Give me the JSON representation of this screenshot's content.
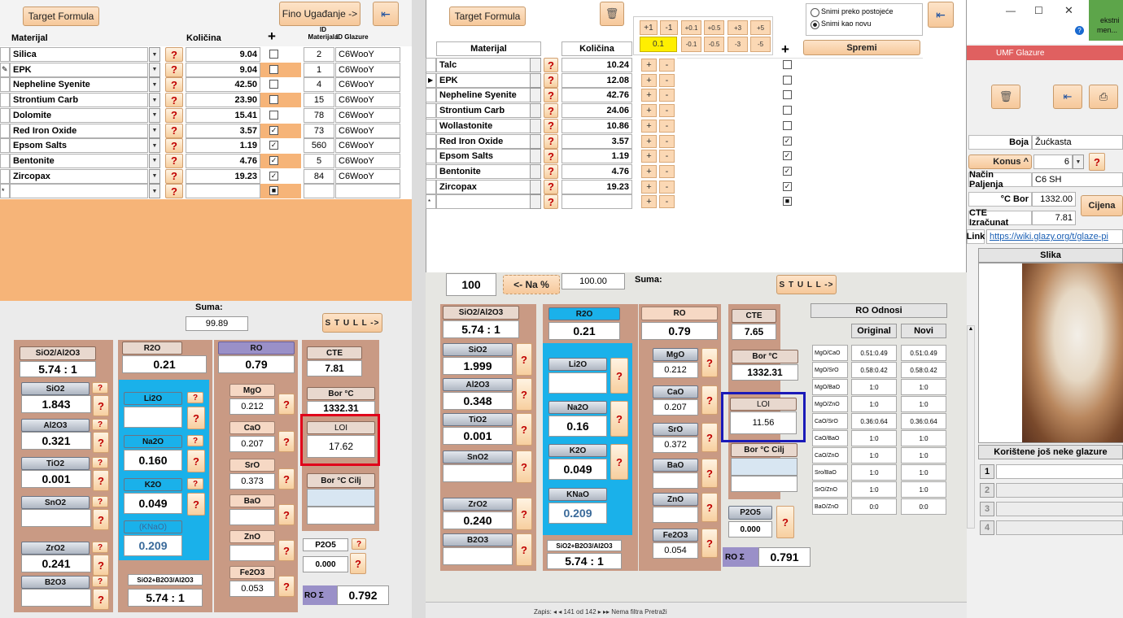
{
  "left": {
    "target_formula": "Target Formula",
    "fino": "Fino Ugađanje ->",
    "col_materijal": "Materijal",
    "col_kolicina": "Količina",
    "col_plus": "+",
    "col_id_mat": "ID Materijala",
    "col_id_glaz": "ID Glazure",
    "rows": [
      {
        "name": "Silica",
        "qty": "9.04",
        "checked": false,
        "id": "2",
        "glaze": "C6WooY"
      },
      {
        "name": "EPK",
        "qty": "9.04",
        "checked": false,
        "id": "1",
        "glaze": "C6WooY"
      },
      {
        "name": "Nepheline Syenite",
        "qty": "42.50",
        "checked": false,
        "id": "4",
        "glaze": "C6WooY"
      },
      {
        "name": "Strontium Carb",
        "qty": "23.90",
        "checked": false,
        "id": "15",
        "glaze": "C6WooY"
      },
      {
        "name": "Dolomite",
        "qty": "15.41",
        "checked": false,
        "id": "78",
        "glaze": "C6WooY"
      },
      {
        "name": "Red Iron Oxide",
        "qty": "3.57",
        "checked": true,
        "id": "73",
        "glaze": "C6WooY"
      },
      {
        "name": "Epsom Salts",
        "qty": "1.19",
        "checked": true,
        "id": "560",
        "glaze": "C6WooY"
      },
      {
        "name": "Bentonite",
        "qty": "4.76",
        "checked": true,
        "id": "5",
        "glaze": "C6WooY"
      },
      {
        "name": "Zircopax",
        "qty": "19.23",
        "checked": true,
        "id": "84",
        "glaze": "C6WooY"
      }
    ],
    "new_row_marker": "*",
    "suma_label": "Suma:",
    "suma_value": "99.89",
    "stull": "S T U L L ->",
    "sio2al2o3_label": "SiO2/Al2O3",
    "sio2al2o3_value": "5.74 : 1",
    "oxides_left": [
      {
        "name": "SiO2",
        "value": "1.843"
      },
      {
        "name": "Al2O3",
        "value": "0.321"
      },
      {
        "name": "TiO2",
        "value": "0.001"
      },
      {
        "name": "SnO2",
        "value": ""
      },
      {
        "name": "ZrO2",
        "value": "0.241"
      },
      {
        "name": "B2O3",
        "value": ""
      }
    ],
    "r2o_label": "R2O",
    "r2o_value": "0.21",
    "r2o_items": [
      {
        "name": "Li2O",
        "value": ""
      },
      {
        "name": "Na2O",
        "value": "0.160"
      },
      {
        "name": "K2O",
        "value": "0.049"
      },
      {
        "name": "(KNaO)",
        "value": "0.209"
      }
    ],
    "ro_label": "RO",
    "ro_value": "0.79",
    "ro_items": [
      {
        "name": "MgO",
        "value": "0.212"
      },
      {
        "name": "CaO",
        "value": "0.207"
      },
      {
        "name": "SrO",
        "value": "0.373"
      },
      {
        "name": "BaO",
        "value": ""
      },
      {
        "name": "ZnO",
        "value": ""
      },
      {
        "name": "Fe2O3",
        "value": "0.053"
      }
    ],
    "cte_label": "CTE",
    "cte_value": "7.81",
    "bor_label": "Bor °C",
    "bor_value": "1332.31",
    "loi_label": "LOI",
    "loi_value": "17.62",
    "bor_cilj_label": "Bor °C Cilj",
    "p2o5_label": "P2O5",
    "p2o5_value": "0.000",
    "sio2b2o3_label": "SiO2+B2O3/Al2O3",
    "sio2b2o3_value": "5.74 : 1",
    "ro_sigma_label": "RO Σ",
    "ro_sigma_value": "0.792"
  },
  "mid": {
    "target_formula": "Target Formula",
    "adj_top": [
      "+1",
      "-1",
      "+0.1",
      "+0.5",
      "+3",
      "+5"
    ],
    "adj_bottom": [
      "0.1",
      "-0.1",
      "-0.5",
      "-3",
      "-5"
    ],
    "radio1": "Snimi preko postojeće",
    "radio2": "Snimi kao novu",
    "spremi": "Spremi",
    "col_materijal": "Materijal",
    "col_kolicina": "Količina",
    "col_plus": "+",
    "rows": [
      {
        "name": "Talc",
        "qty": "10.24",
        "checked": false
      },
      {
        "name": "EPK",
        "qty": "12.08",
        "checked": false
      },
      {
        "name": "Nepheline Syenite",
        "qty": "42.76",
        "checked": false
      },
      {
        "name": "Strontium Carb",
        "qty": "24.06",
        "checked": false
      },
      {
        "name": "Wollastonite",
        "qty": "10.86",
        "checked": false
      },
      {
        "name": "Red Iron Oxide",
        "qty": "3.57",
        "checked": true
      },
      {
        "name": "Epsom Salts",
        "qty": "1.19",
        "checked": true
      },
      {
        "name": "Bentonite",
        "qty": "4.76",
        "checked": true
      },
      {
        "name": "Zircopax",
        "qty": "19.23",
        "checked": true
      }
    ],
    "new_row_marker": "*",
    "hundred": "100",
    "na_pct": "<- Na %",
    "hundred_value": "100.00",
    "suma_label": "Suma:",
    "stull": "S T U L L ->",
    "sio2al2o3_label": "SiO2/Al2O3",
    "sio2al2o3_value": "5.74 : 1",
    "oxides_left": [
      {
        "name": "SiO2",
        "value": "1.999"
      },
      {
        "name": "Al2O3",
        "value": "0.348"
      },
      {
        "name": "TiO2",
        "value": "0.001"
      },
      {
        "name": "SnO2",
        "value": ""
      },
      {
        "name": "ZrO2",
        "value": "0.240"
      },
      {
        "name": "B2O3",
        "value": ""
      }
    ],
    "r2o_label": "R2O",
    "r2o_value": "0.21",
    "r2o_items": [
      {
        "name": "Li2O",
        "value": ""
      },
      {
        "name": "Na2O",
        "value": "0.16"
      },
      {
        "name": "K2O",
        "value": "0.049"
      },
      {
        "name": "KNaO",
        "value": "0.209"
      }
    ],
    "sio2b2o3_label": "SiO2+B2O3/Al2O3",
    "sio2b2o3_value": "5.74 : 1",
    "ro_label": "RO",
    "ro_value": "0.79",
    "ro_items": [
      {
        "name": "MgO",
        "value": "0.212"
      },
      {
        "name": "CaO",
        "value": "0.207"
      },
      {
        "name": "SrO",
        "value": "0.372"
      },
      {
        "name": "BaO",
        "value": ""
      },
      {
        "name": "ZnO",
        "value": ""
      },
      {
        "name": "Fe2O3",
        "value": "0.054"
      }
    ],
    "cte_label": "CTE",
    "cte_value": "7.65",
    "bor_label": "Bor °C",
    "bor_value": "1332.31",
    "loi_label": "LOI",
    "loi_value": "11.56",
    "bor_cilj_label": "Bor °C Cilj",
    "p2o5_label": "P2O5",
    "p2o5_value": "0.000",
    "ro_sigma_label": "RO Σ",
    "ro_sigma_value": "0.791",
    "ro_odnosi_title": "RO Odnosi",
    "ro_odnosi_original": "Original",
    "ro_odnosi_novi": "Novi",
    "ro_odnosi_rows": [
      {
        "label": "MgO/CaO",
        "orig": "0.51:0.49",
        "novi": "0.51:0.49"
      },
      {
        "label": "MgO/SrO",
        "orig": "0.58:0.42",
        "novi": "0.58:0.42"
      },
      {
        "label": "MgO/BaO",
        "orig": "1:0",
        "novi": "1:0"
      },
      {
        "label": "MgO/ZnO",
        "orig": "1:0",
        "novi": "1:0"
      },
      {
        "label": "CaO/SrO",
        "orig": "0.36:0.64",
        "novi": "0.36:0.64"
      },
      {
        "label": "CaO/BaO",
        "orig": "1:0",
        "novi": "1:0"
      },
      {
        "label": "CaO/ZnO",
        "orig": "1:0",
        "novi": "1:0"
      },
      {
        "label": "Sro/BaO",
        "orig": "1:0",
        "novi": "1:0"
      },
      {
        "label": "SrO/ZnO",
        "orig": "1:0",
        "novi": "1:0"
      },
      {
        "label": "BaO/ZnO",
        "orig": "0:0",
        "novi": "0:0"
      }
    ],
    "status": "Zapis: ◂ ◂ 141 od 142 ▸ ▸▸  Nema filtra  Pretraži"
  },
  "right": {
    "tekstni": "ekstni",
    "men": "men...",
    "umf_title": "UMF Glazure",
    "boja_label": "Boja",
    "boja_value": "Žućkasta",
    "konus_label": "Konus ^",
    "konus_value": "6",
    "nacin_label": "Način Paljenja",
    "nacin_value": "C6 SH",
    "bor_label": "°C Bor",
    "bor_value": "1332.00",
    "cte_label": "CTE Izračunat",
    "cte_value": "7.81",
    "cijena": "Cijena",
    "link_label": "Link",
    "link_value": "https://wiki.glazy.org/t/glaze-pi",
    "slika": "Slika",
    "koristene": "Korištene još neke glazure",
    "nums": [
      "1",
      "2",
      "3",
      "4"
    ]
  },
  "colors": {
    "orange": "#f6b478",
    "panel": "#c99a84",
    "blue": "#1ab1ea",
    "red_box": "#e0001a",
    "navy_box": "#1a1ab8",
    "umf": "#e06060"
  }
}
